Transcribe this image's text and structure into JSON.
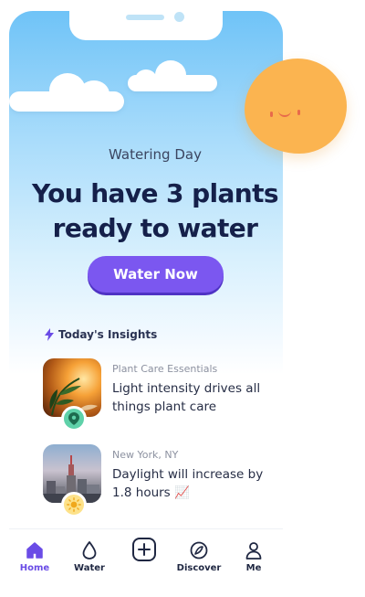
{
  "header": {
    "eyebrow": "Watering Day",
    "headline_line1": "You have 3 plants",
    "headline_line2": "ready to water"
  },
  "cta": {
    "label": "Water Now"
  },
  "insights": {
    "title": "Today's Insights",
    "items": [
      {
        "source": "Plant Care Essentials",
        "text": "Light intensity drives all things plant care",
        "thumbnail": "plant-photo",
        "badge_icon": "location-pin-icon"
      },
      {
        "source": "New York, NY",
        "text": "Daylight will increase by 1.8 hours 📈",
        "thumbnail": "city-photo",
        "badge_icon": "sun-icon"
      }
    ]
  },
  "tabbar": {
    "items": [
      {
        "label": "Home",
        "icon": "home-icon",
        "active": true
      },
      {
        "label": "Water",
        "icon": "water-drop-icon",
        "active": false
      },
      {
        "label": "",
        "icon": "add-icon",
        "active": false
      },
      {
        "label": "Discover",
        "icon": "compass-icon",
        "active": false
      },
      {
        "label": "Me",
        "icon": "person-icon",
        "active": false
      }
    ]
  },
  "colors": {
    "accent": "#7b57f0",
    "headline": "#15204a",
    "sun": "#fbb450",
    "sky_top": "#6fc3f7"
  }
}
